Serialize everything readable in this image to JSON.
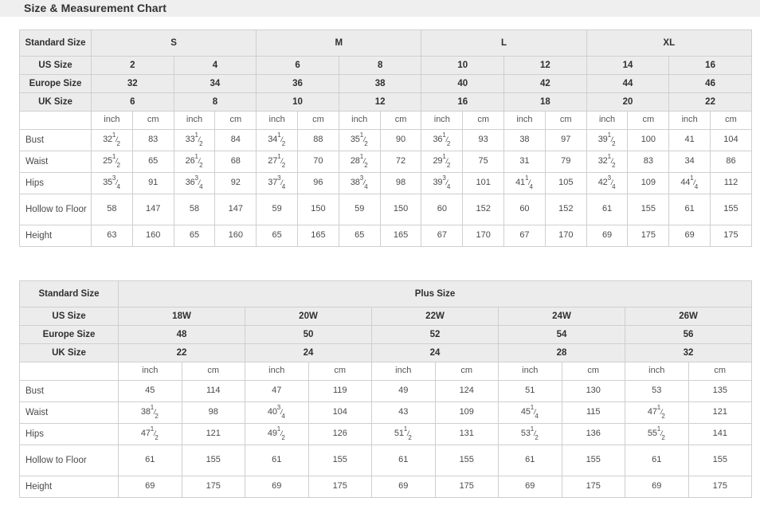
{
  "title": "Size & Measurement Chart",
  "table1": {
    "name": "standard-size-chart",
    "corner_label": "Standard Size",
    "group_headers": [
      "S",
      "M",
      "L",
      "XL"
    ],
    "row_labels": {
      "us": "US Size",
      "europe": "Europe Size",
      "uk": "UK Size"
    },
    "us_sizes": [
      "2",
      "4",
      "6",
      "8",
      "10",
      "12",
      "14",
      "16"
    ],
    "europe_sizes": [
      "32",
      "34",
      "36",
      "38",
      "40",
      "42",
      "44",
      "46"
    ],
    "uk_sizes": [
      "6",
      "8",
      "10",
      "12",
      "16",
      "18",
      "20",
      "22"
    ],
    "unit_labels": [
      "inch",
      "cm",
      "inch",
      "cm",
      "inch",
      "cm",
      "inch",
      "cm",
      "inch",
      "cm",
      "inch",
      "cm",
      "inch",
      "cm",
      "inch",
      "cm"
    ],
    "measurements": [
      {
        "label": "Bust",
        "values": [
          "32 1/2",
          "83",
          "33 1/2",
          "84",
          "34 1/2",
          "88",
          "35 1/2",
          "90",
          "36 1/2",
          "93",
          "38",
          "97",
          "39 1/2",
          "100",
          "41",
          "104"
        ]
      },
      {
        "label": "Waist",
        "values": [
          "25 1/2",
          "65",
          "26 1/2",
          "68",
          "27 1/2",
          "70",
          "28 1/2",
          "72",
          "29 1/2",
          "75",
          "31",
          "79",
          "32 1/2",
          "83",
          "34",
          "86"
        ]
      },
      {
        "label": "Hips",
        "values": [
          "35 3/4",
          "91",
          "36 3/4",
          "92",
          "37 3/4",
          "96",
          "38 3/4",
          "98",
          "39 3/4",
          "101",
          "41 1/4",
          "105",
          "42 3/4",
          "109",
          "44 1/4",
          "112"
        ]
      },
      {
        "label": "Hollow to Floor",
        "values": [
          "58",
          "147",
          "58",
          "147",
          "59",
          "150",
          "59",
          "150",
          "60",
          "152",
          "60",
          "152",
          "61",
          "155",
          "61",
          "155"
        ]
      },
      {
        "label": "Height",
        "values": [
          "63",
          "160",
          "65",
          "160",
          "65",
          "165",
          "65",
          "165",
          "67",
          "170",
          "67",
          "170",
          "69",
          "175",
          "69",
          "175"
        ]
      }
    ]
  },
  "table2": {
    "name": "plus-size-chart",
    "corner_label": "Standard Size",
    "group_header": "Plus Size",
    "row_labels": {
      "us": "US Size",
      "europe": "Europe Size",
      "uk": "UK Size"
    },
    "us_sizes": [
      "18W",
      "20W",
      "22W",
      "24W",
      "26W"
    ],
    "europe_sizes": [
      "48",
      "50",
      "52",
      "54",
      "56"
    ],
    "uk_sizes": [
      "22",
      "24",
      "24",
      "28",
      "32"
    ],
    "unit_labels": [
      "inch",
      "cm",
      "inch",
      "cm",
      "inch",
      "cm",
      "inch",
      "cm",
      "inch",
      "cm"
    ],
    "measurements": [
      {
        "label": "Bust",
        "values": [
          "45",
          "114",
          "47",
          "119",
          "49",
          "124",
          "51",
          "130",
          "53",
          "135"
        ]
      },
      {
        "label": "Waist",
        "values": [
          "38 1/2",
          "98",
          "40 3/4",
          "104",
          "43",
          "109",
          "45 1/4",
          "115",
          "47 1/2",
          "121"
        ]
      },
      {
        "label": "Hips",
        "values": [
          "47 1/2",
          "121",
          "49 1/2",
          "126",
          "51 1/2",
          "131",
          "53 1/2",
          "136",
          "55 1/2",
          "141"
        ]
      },
      {
        "label": "Hollow to Floor",
        "values": [
          "61",
          "155",
          "61",
          "155",
          "61",
          "155",
          "61",
          "155",
          "61",
          "155"
        ]
      },
      {
        "label": "Height",
        "values": [
          "69",
          "175",
          "69",
          "175",
          "69",
          "175",
          "69",
          "175",
          "69",
          "175"
        ]
      }
    ]
  },
  "colors": {
    "header_band": "#efefef",
    "table_header": "#ececec",
    "border": "#cfcfcf",
    "text": "#4a4a4a",
    "heading_text": "#333333"
  }
}
